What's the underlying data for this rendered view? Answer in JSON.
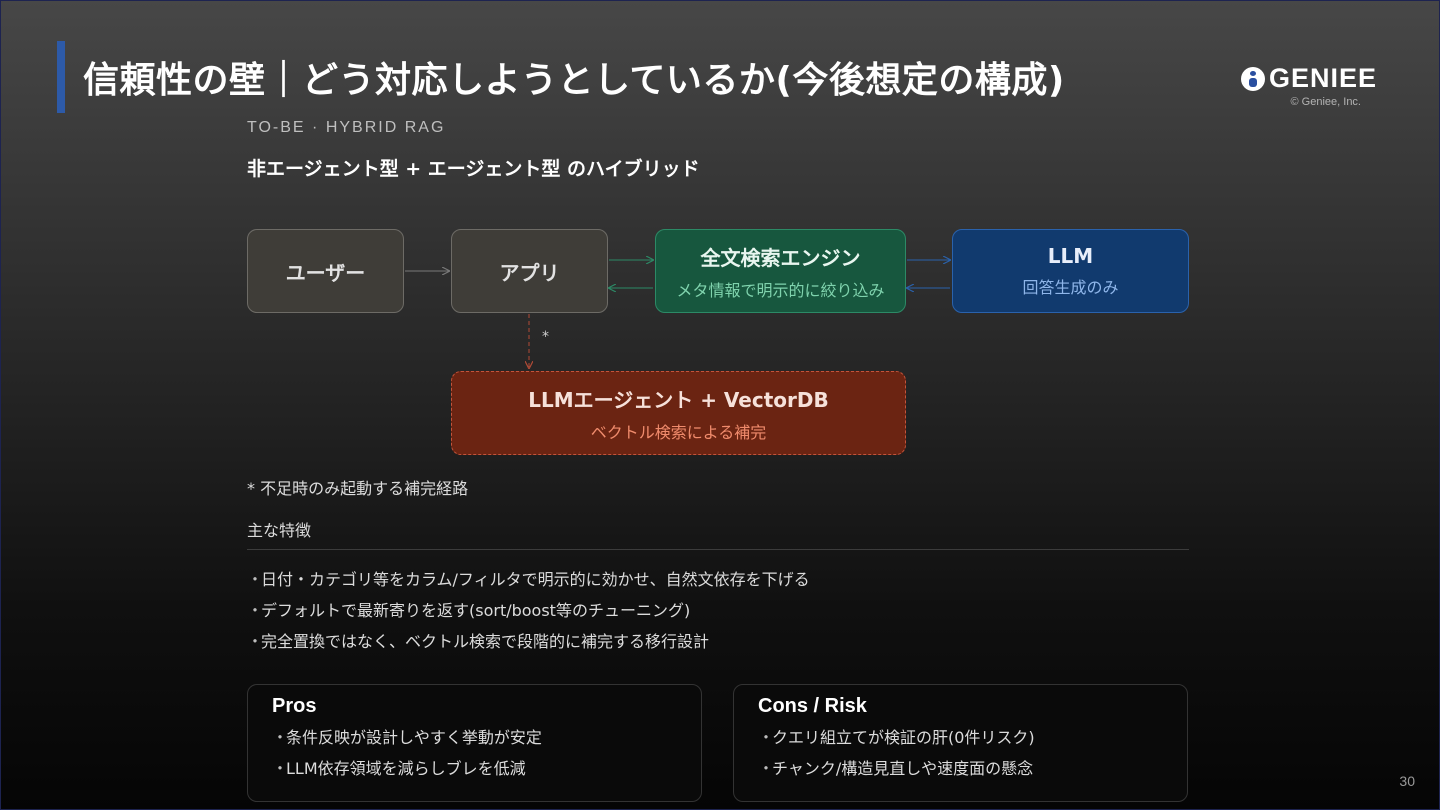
{
  "slide": {
    "title": "信頼性の壁｜どう対応しようとしているか(今後想定の構成)",
    "logo_text": "GENIEE",
    "copyright": "© Geniee, Inc.",
    "eyebrow": "TO-BE · HYBRID RAG",
    "subtitle": "非エージェント型 + エージェント型 のハイブリッド",
    "page_number": "30"
  },
  "diagram": {
    "nodes": {
      "user": {
        "label": "ユーザー"
      },
      "app": {
        "label": "アプリ"
      },
      "search": {
        "label": "全文検索エンジン",
        "sub": "メタ情報で明示的に絞り込み"
      },
      "llm": {
        "label": "LLM",
        "sub": "回答生成のみ"
      },
      "agent": {
        "label": "LLMエージェント + VectorDB",
        "sub": "ベクトル検索による補完"
      }
    },
    "edge_marker": "*",
    "colors": {
      "search": "#17573e",
      "llm": "#113a6e",
      "agent": "#6b2412",
      "neutral": "#3f3d38"
    }
  },
  "footnote": "* 不足時のみ起動する補完経路",
  "features": {
    "title": "主な特徴",
    "items": [
      "日付・カテゴリ等をカラム/フィルタで明示的に効かせ、自然文依存を下げる",
      "デフォルトで最新寄りを返す(sort/boost等のチューニング)",
      "完全置換ではなく、ベクトル検索で段階的に補完する移行設計"
    ]
  },
  "pros": {
    "title": "Pros",
    "items": [
      "条件反映が設計しやすく挙動が安定",
      "LLM依存領域を減らしブレを低減"
    ]
  },
  "cons": {
    "title": "Cons / Risk",
    "items": [
      "クエリ組立てが検証の肝(0件リスク)",
      "チャンク/構造見直しや速度面の懸念"
    ]
  },
  "bullet": "・"
}
